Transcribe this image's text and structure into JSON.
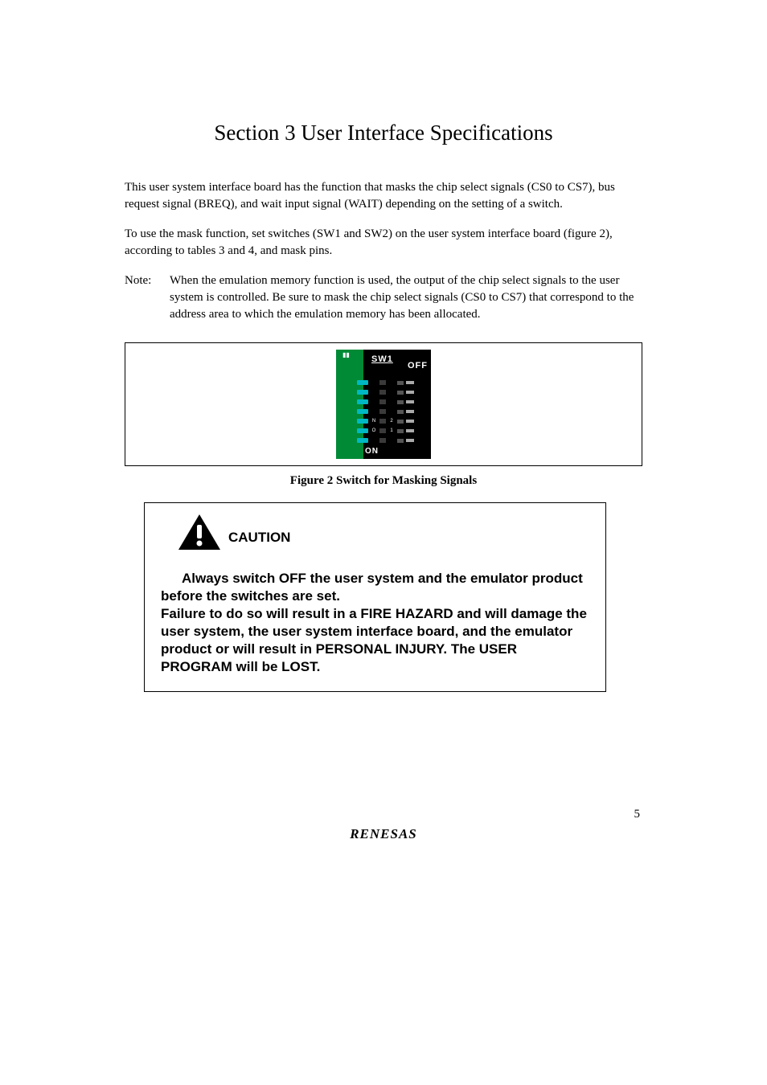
{
  "title": "Section 3   User Interface Specifications",
  "p1": "This user system interface board has the function that masks the chip select signals (CS0 to CS7), bus request signal (BREQ), and wait input signal (WAIT) depending on the setting of a switch.",
  "p2": "To use the mask function, set switches (SW1 and SW2) on the user system interface board (figure 2), according to tables 3 and 4, and mask pins.",
  "note_label": "Note:",
  "note_body": "When the emulation memory function is used, the output of the chip select signals to the user system is controlled. Be sure to mask the chip select signals (CS0 to CS7) that correspond to the address area to which the emulation memory has been allocated.",
  "switch": {
    "name": "SW1",
    "off": "OFF",
    "on": "ON"
  },
  "figure_caption": "Figure 2   Switch for Masking Signals",
  "caution_heading": "CAUTION",
  "caution_line1_lead": "Always switch OFF the user system and the emulator",
  "caution_rest": "product before the switches are set.\nFailure to do so will result in a FIRE HAZARD and will damage the user system, the user system interface board, and the emulator product or will result in PERSONAL INJURY.  The USER PROGRAM will be LOST.",
  "page_number": "5",
  "brand": "RENESAS"
}
